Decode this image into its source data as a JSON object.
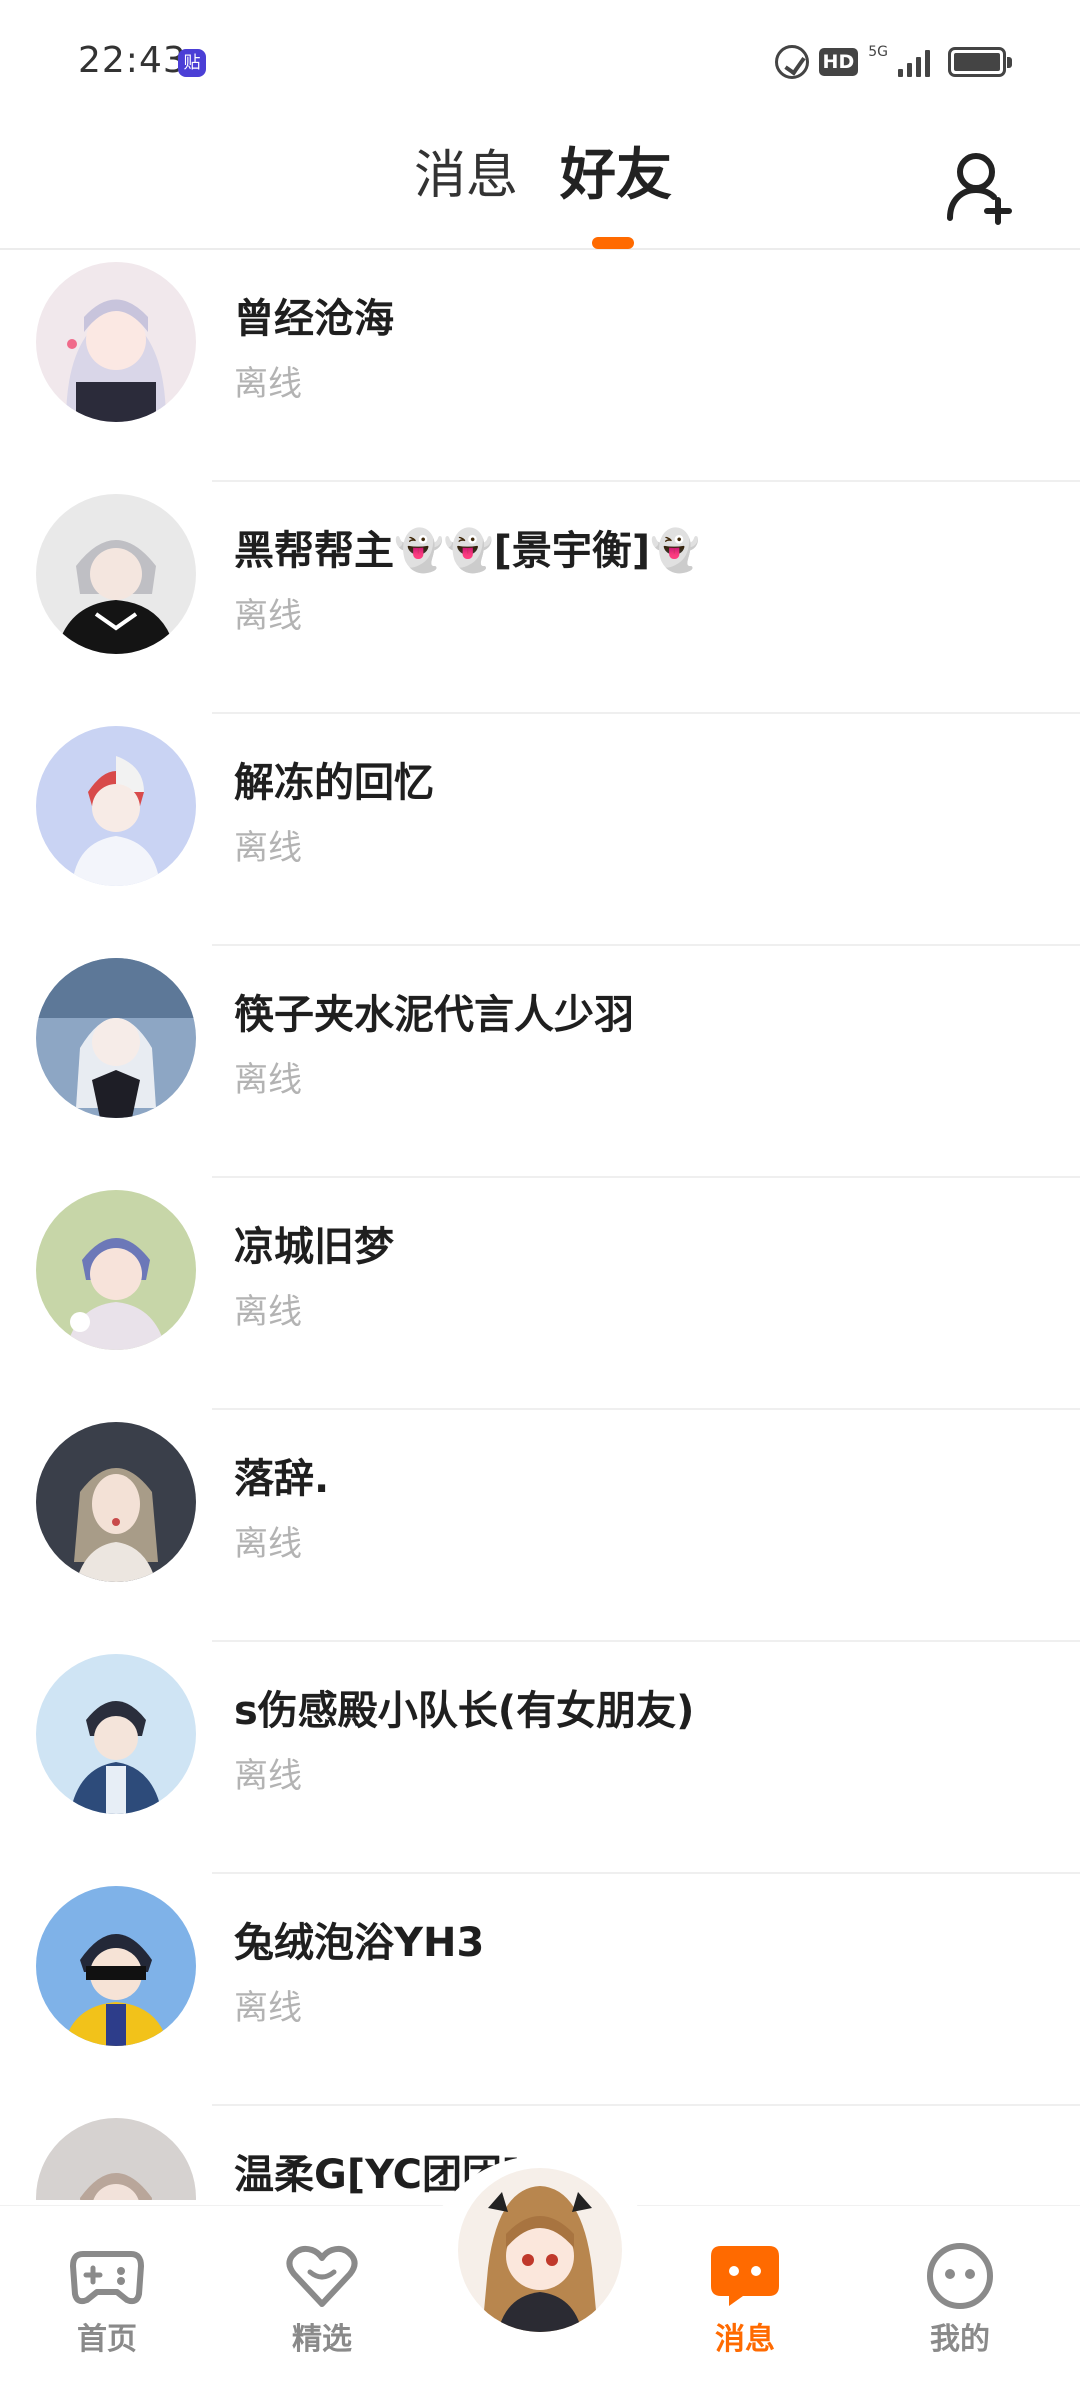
{
  "status_bar": {
    "time": "22:43",
    "app_badge": "贴",
    "hd_label": "HD",
    "network_label": "5G"
  },
  "header": {
    "tabs": [
      {
        "label": "消息",
        "active": false
      },
      {
        "label": "好友",
        "active": true
      }
    ],
    "add_friend_icon": "add-user-icon",
    "accent_color": "#ff6a00"
  },
  "friends": [
    {
      "name": "曾经沧海",
      "status": "离线"
    },
    {
      "name": "黑帮帮主👻👻[景宇衡]👻",
      "status": "离线"
    },
    {
      "name": "解冻的回忆",
      "status": "离线"
    },
    {
      "name": "筷子夹水泥代言人少羽",
      "status": "离线"
    },
    {
      "name": "凉城旧梦",
      "status": "离线"
    },
    {
      "name": "落辞.",
      "status": "离线"
    },
    {
      "name": "s伤感殿小队长(有女朋友)",
      "status": "离线"
    },
    {
      "name": "兔绒泡浴YH3",
      "status": "离线"
    },
    {
      "name": "温柔G[YC团团]",
      "status": ""
    }
  ],
  "bottom_nav": {
    "items": [
      {
        "label": "首页",
        "icon": "gamepad-icon",
        "active": false
      },
      {
        "label": "精选",
        "icon": "heart-icon",
        "active": false
      },
      {
        "label": "",
        "icon": "avatar-center",
        "active": false
      },
      {
        "label": "消息",
        "icon": "chat-bubble-icon",
        "active": true
      },
      {
        "label": "我的",
        "icon": "face-icon",
        "active": false
      }
    ]
  }
}
